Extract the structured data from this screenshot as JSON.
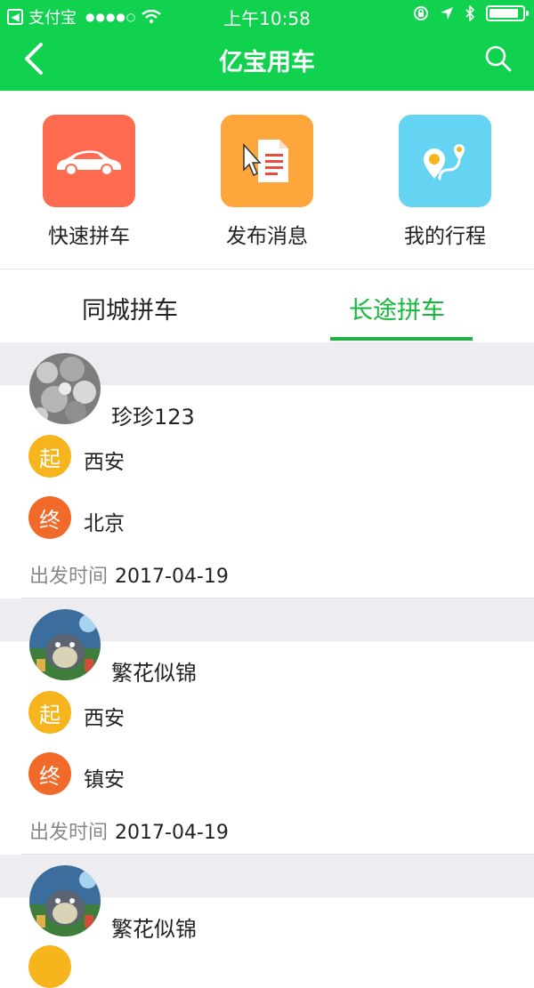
{
  "status_bar": {
    "back_glyph": "◀",
    "carrier": "支付宝",
    "signal_dots": "●●●●○",
    "time": "上午10:58",
    "battery_level": 0.9
  },
  "nav": {
    "title": "亿宝用车",
    "back_icon": "chevron-left-icon",
    "search_icon": "search-icon",
    "color": "#10d24f"
  },
  "actions": [
    {
      "label": "快速拼车",
      "icon": "car-icon",
      "color": "#fe6b50"
    },
    {
      "label": "发布消息",
      "icon": "document-pointer-icon",
      "color": "#fea53c"
    },
    {
      "label": "我的行程",
      "icon": "map-pin-route-icon",
      "color": "#65d3f2"
    }
  ],
  "tabs": {
    "items": [
      "同城拼车",
      "长途拼车"
    ],
    "active_index": 1,
    "active_color": "#15b83a"
  },
  "posts": [
    {
      "username": "珍珍123",
      "start_tag": "起",
      "start": "西安",
      "end_tag": "终",
      "end": "北京",
      "depart_label": "出发时间",
      "depart_date": "2017-04-19",
      "avatar": "gray-textured-avatar"
    },
    {
      "username": "繁花似锦",
      "start_tag": "起",
      "start": "西安",
      "end_tag": "终",
      "end": "镇安",
      "depart_label": "出发时间",
      "depart_date": "2017-04-19",
      "avatar": "anime-totoro-avatar"
    },
    {
      "username": "繁花似锦",
      "avatar": "anime-totoro-avatar"
    }
  ]
}
